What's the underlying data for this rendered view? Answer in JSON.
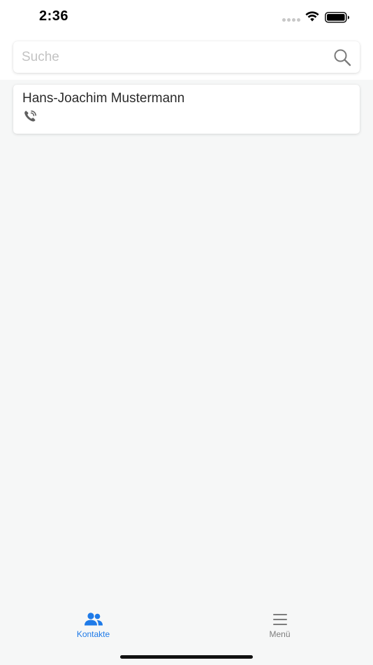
{
  "status_bar": {
    "time": "2:36",
    "icons": [
      "signal-icon",
      "wifi-icon",
      "battery-icon"
    ]
  },
  "search": {
    "placeholder": "Suche",
    "value": "",
    "icon": "search-icon"
  },
  "contacts": [
    {
      "name": "Hans-Joachim Mustermann",
      "icon": "phone-icon"
    }
  ],
  "tab_bar": {
    "items": [
      {
        "label": "Kontakte",
        "icon": "people-icon",
        "active": true
      },
      {
        "label": "Menü",
        "icon": "hamburger-menu-icon",
        "active": false
      }
    ]
  },
  "colors": {
    "accent": "#1e7ae8",
    "background": "#f6f7f7",
    "inactive": "#7d7d7d"
  }
}
